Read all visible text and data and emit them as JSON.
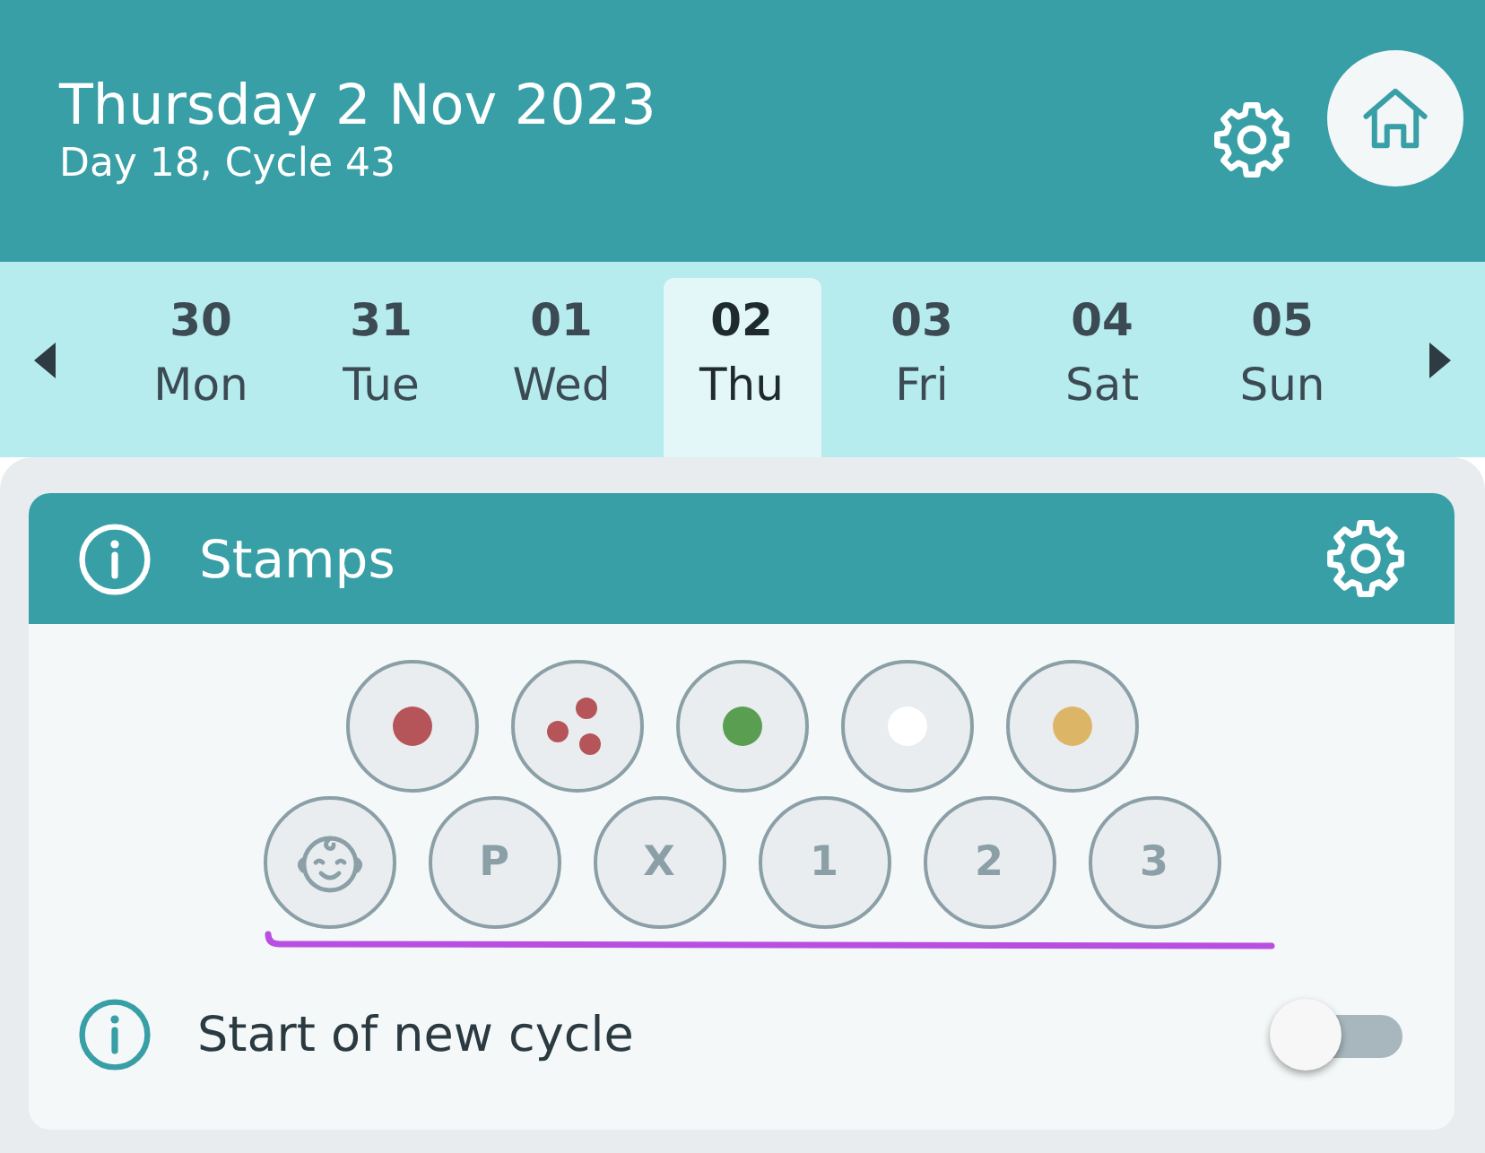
{
  "header": {
    "title": "Thursday 2 Nov 2023",
    "subtitle": "Day 18, Cycle 43"
  },
  "days": [
    {
      "number": "30",
      "weekday": "Mon",
      "selected": false
    },
    {
      "number": "31",
      "weekday": "Tue",
      "selected": false
    },
    {
      "number": "01",
      "weekday": "Wed",
      "selected": false
    },
    {
      "number": "02",
      "weekday": "Thu",
      "selected": true
    },
    {
      "number": "03",
      "weekday": "Fri",
      "selected": false
    },
    {
      "number": "04",
      "weekday": "Sat",
      "selected": false
    },
    {
      "number": "05",
      "weekday": "Sun",
      "selected": false
    }
  ],
  "stamps_card": {
    "title": "Stamps",
    "stamp_rows": [
      [
        {
          "kind": "dot",
          "color": "#b5555a"
        },
        {
          "kind": "spots",
          "color": "#b5555a"
        },
        {
          "kind": "dot",
          "color": "#5a9e52"
        },
        {
          "kind": "dot",
          "color": "#ffffff"
        },
        {
          "kind": "dot",
          "color": "#dcb566"
        }
      ],
      [
        {
          "kind": "baby"
        },
        {
          "kind": "letter",
          "label": "P"
        },
        {
          "kind": "letter",
          "label": "X"
        },
        {
          "kind": "letter",
          "label": "1"
        },
        {
          "kind": "letter",
          "label": "2"
        },
        {
          "kind": "letter",
          "label": "3"
        }
      ]
    ]
  },
  "new_cycle": {
    "label": "Start of new cycle",
    "on": false
  }
}
